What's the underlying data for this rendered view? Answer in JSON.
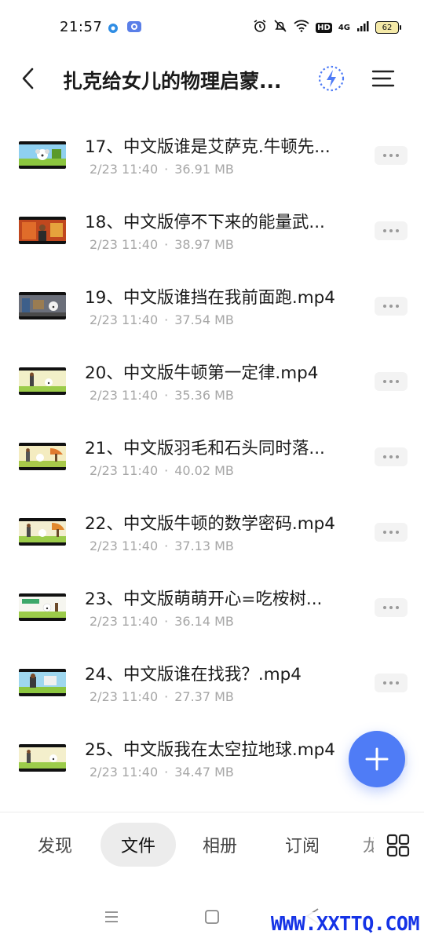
{
  "status_bar": {
    "time": "21:57",
    "network": "4G",
    "hd": "HD",
    "battery": "62"
  },
  "header": {
    "title": "扎克给女儿的物理启蒙...",
    "icons": [
      "back-arrow-icon",
      "lightning-icon",
      "menu-icon"
    ],
    "accent_color": "#4f7cf6"
  },
  "files": [
    {
      "name": "17、中文版谁是艾萨克.牛顿先...",
      "date": "2/23 11:40",
      "size": "36.91 MB"
    },
    {
      "name": "18、中文版停不下来的能量武...",
      "date": "2/23 11:40",
      "size": "38.97 MB"
    },
    {
      "name": "19、中文版谁挡在我前面跑.mp4",
      "date": "2/23 11:40",
      "size": "37.54 MB"
    },
    {
      "name": "20、中文版牛顿第一定律.mp4",
      "date": "2/23 11:40",
      "size": "35.36 MB"
    },
    {
      "name": "21、中文版羽毛和石头同时落...",
      "date": "2/23 11:40",
      "size": "40.02 MB"
    },
    {
      "name": "22、中文版牛顿的数学密码.mp4",
      "date": "2/23 11:40",
      "size": "37.13 MB"
    },
    {
      "name": "23、中文版萌萌开心=吃桉树...",
      "date": "2/23 11:40",
      "size": "36.14 MB"
    },
    {
      "name": "24、中文版谁在找我？.mp4",
      "date": "2/23 11:40",
      "size": "27.37 MB"
    },
    {
      "name": "25、中文版我在太空拉地球.mp4",
      "date": "2/23 11:40",
      "size": "34.47 MB"
    }
  ],
  "tabs": [
    {
      "label": "发现",
      "active": false
    },
    {
      "label": "文件",
      "active": true
    },
    {
      "label": "相册",
      "active": false
    },
    {
      "label": "订阅",
      "active": false
    },
    {
      "label": "龙",
      "active": false
    }
  ],
  "watermark": "WWW.XXTTQ.COM"
}
